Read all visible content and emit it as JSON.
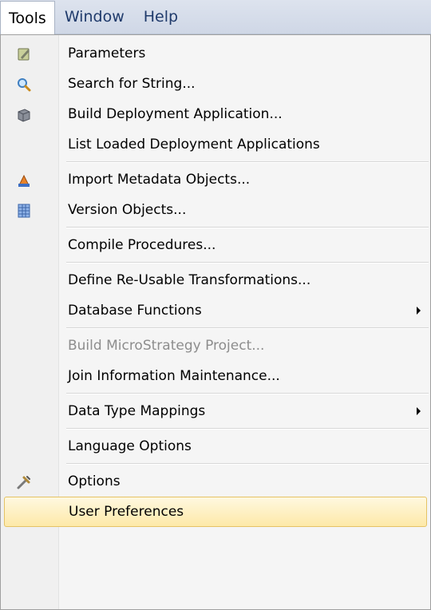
{
  "menubar": {
    "items": [
      {
        "label": "Tools",
        "active": true
      },
      {
        "label": "Window",
        "active": false
      },
      {
        "label": "Help",
        "active": false
      }
    ]
  },
  "menu": {
    "items": [
      {
        "label": "Parameters",
        "icon": "parameters-icon"
      },
      {
        "label": "Search for String...",
        "icon": "search-icon"
      },
      {
        "label": "Build Deployment Application...",
        "icon": "deployment-icon"
      },
      {
        "label": "List Loaded Deployment Applications"
      },
      {
        "label": "Import Metadata Objects...",
        "icon": "import-icon"
      },
      {
        "label": "Version Objects...",
        "icon": "version-icon"
      },
      {
        "label": "Compile Procedures..."
      },
      {
        "label": "Define Re-Usable Transformations..."
      },
      {
        "label": "Database Functions",
        "submenu": true
      },
      {
        "label": "Build MicroStrategy Project...",
        "disabled": true
      },
      {
        "label": "Join Information Maintenance..."
      },
      {
        "label": "Data Type Mappings",
        "submenu": true
      },
      {
        "label": "Language Options"
      },
      {
        "label": "Options",
        "icon": "options-icon"
      },
      {
        "label": "User Preferences",
        "highlighted": true
      }
    ]
  },
  "colors": {
    "menubar_bg": "#cfd7e6",
    "highlight_bg": "#fde9a8",
    "highlight_border": "#e5c365",
    "disabled_text": "#8d8d8d"
  }
}
